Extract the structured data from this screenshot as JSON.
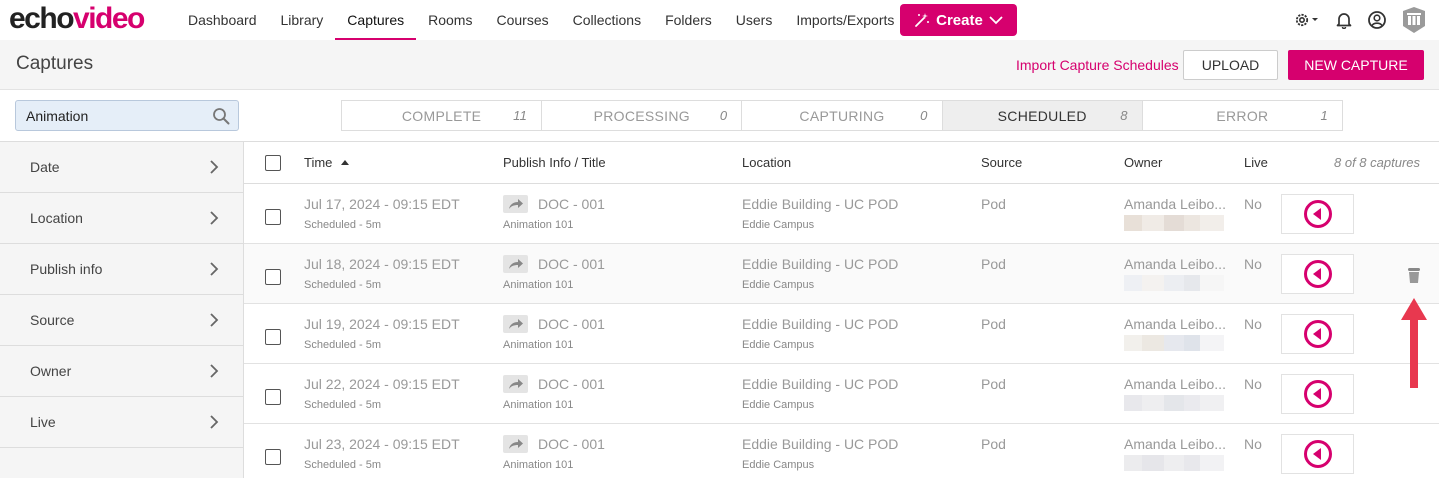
{
  "app": {
    "logo_part1": "echo",
    "logo_part2": "video"
  },
  "nav": {
    "items": [
      {
        "label": "Dashboard",
        "active": false
      },
      {
        "label": "Library",
        "active": false
      },
      {
        "label": "Captures",
        "active": true
      },
      {
        "label": "Rooms",
        "active": false
      },
      {
        "label": "Courses",
        "active": false
      },
      {
        "label": "Collections",
        "active": false
      },
      {
        "label": "Folders",
        "active": false
      },
      {
        "label": "Users",
        "active": false
      },
      {
        "label": "Imports/Exports",
        "active": false
      }
    ],
    "create_label": "Create"
  },
  "header": {
    "title": "Captures",
    "import_link": "Import Capture Schedules",
    "upload_label": "UPLOAD",
    "new_capture_label": "NEW CAPTURE"
  },
  "search": {
    "value": "Animation"
  },
  "status_tabs": [
    {
      "label": "COMPLETE",
      "count": "11",
      "active": false
    },
    {
      "label": "PROCESSING",
      "count": "0",
      "active": false
    },
    {
      "label": "CAPTURING",
      "count": "0",
      "active": false
    },
    {
      "label": "SCHEDULED",
      "count": "8",
      "active": true
    },
    {
      "label": "ERROR",
      "count": "1",
      "active": false
    }
  ],
  "filters": [
    "Date",
    "Location",
    "Publish info",
    "Source",
    "Owner",
    "Live"
  ],
  "table": {
    "columns": {
      "time": "Time",
      "publish": "Publish Info / Title",
      "location": "Location",
      "source": "Source",
      "owner": "Owner",
      "live": "Live"
    },
    "count_label": "8 of 8 captures",
    "rows": [
      {
        "time": "Jul 17, 2024 - 09:15 EDT",
        "status": "Scheduled - 5m",
        "title": "DOC - 001",
        "course": "Animation 101",
        "location": "Eddie Building - UC POD",
        "campus": "Eddie Campus",
        "source": "Pod",
        "owner": "Amanda Leibo...",
        "live": "No"
      },
      {
        "time": "Jul 18, 2024 - 09:15 EDT",
        "status": "Scheduled - 5m",
        "title": "DOC - 001",
        "course": "Animation 101",
        "location": "Eddie Building - UC POD",
        "campus": "Eddie Campus",
        "source": "Pod",
        "owner": "Amanda Leibo...",
        "live": "No"
      },
      {
        "time": "Jul 19, 2024 - 09:15 EDT",
        "status": "Scheduled - 5m",
        "title": "DOC - 001",
        "course": "Animation 101",
        "location": "Eddie Building - UC POD",
        "campus": "Eddie Campus",
        "source": "Pod",
        "owner": "Amanda Leibo...",
        "live": "No"
      },
      {
        "time": "Jul 22, 2024 - 09:15 EDT",
        "status": "Scheduled - 5m",
        "title": "DOC - 001",
        "course": "Animation 101",
        "location": "Eddie Building - UC POD",
        "campus": "Eddie Campus",
        "source": "Pod",
        "owner": "Amanda Leibo...",
        "live": "No"
      },
      {
        "time": "Jul 23, 2024 - 09:15 EDT",
        "status": "Scheduled - 5m",
        "title": "DOC - 001",
        "course": "Animation 101",
        "location": "Eddie Building - UC POD",
        "campus": "Eddie Campus",
        "source": "Pod",
        "owner": "Amanda Leibo...",
        "live": "No"
      }
    ]
  },
  "colors": {
    "brand": "#d6006e",
    "annotation_arrow": "#e8384f"
  },
  "icons": [
    "search-icon",
    "gear-icon",
    "bell-icon",
    "user-icon",
    "avatar-icon",
    "chevron-right-icon",
    "share-arrow-icon",
    "play-back-icon",
    "trash-icon",
    "sort-asc-icon",
    "magic-wand-icon"
  ]
}
